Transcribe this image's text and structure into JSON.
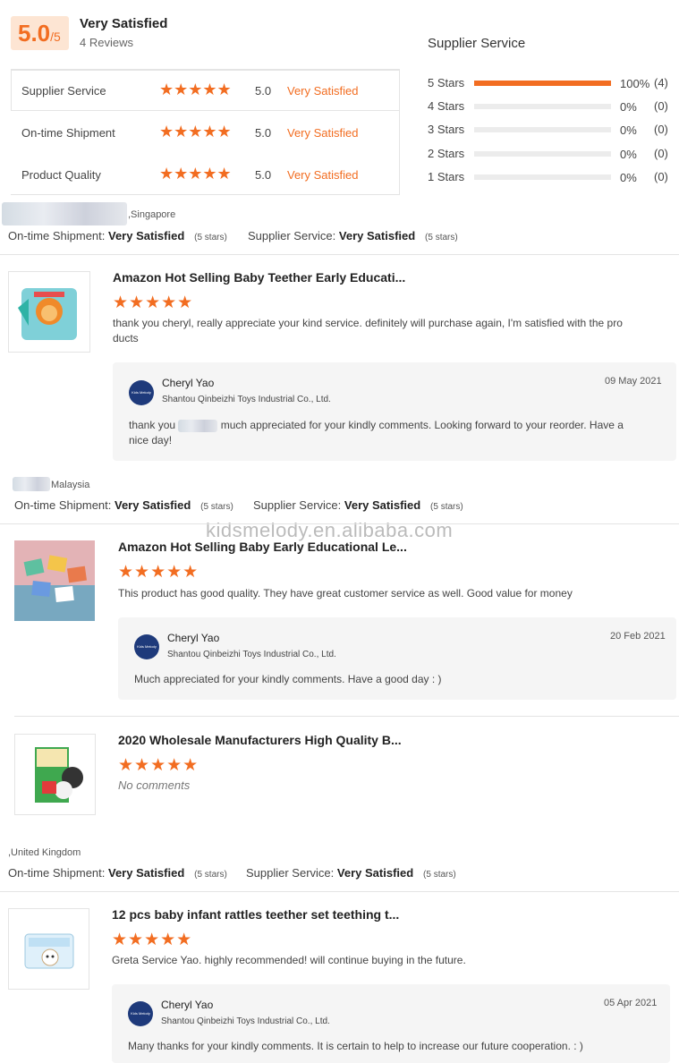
{
  "summary": {
    "score": "5.0",
    "score_suffix": "/5",
    "label": "Very Satisfied",
    "reviews": "4 Reviews"
  },
  "ratings": [
    {
      "label": "Supplier Service",
      "score": "5.0",
      "status": "Very Satisfied"
    },
    {
      "label": "On-time Shipment",
      "score": "5.0",
      "status": "Very Satisfied"
    },
    {
      "label": "Product Quality",
      "score": "5.0",
      "status": "Very Satisfied"
    }
  ],
  "distribution": {
    "title": "Supplier Service",
    "rows": [
      {
        "label": "5 Stars",
        "fraction": 1.0,
        "pct": "100%",
        "count": "(4)"
      },
      {
        "label": "4 Stars",
        "fraction": 0.0,
        "pct": "0%",
        "count": "(0)"
      },
      {
        "label": "3 Stars",
        "fraction": 0.0,
        "pct": "0%",
        "count": "(0)"
      },
      {
        "label": "2 Stars",
        "fraction": 0.0,
        "pct": "0%",
        "count": "(0)"
      },
      {
        "label": "1 Stars",
        "fraction": 0.0,
        "pct": "0%",
        "count": "(0)"
      }
    ]
  },
  "stars_glyph": "★★★★★",
  "meta_labels": {
    "shipment": "On-time Shipment:",
    "service": "Supplier Service:",
    "value": "Very Satisfied",
    "stars_note": "(5 stars)"
  },
  "reviews": [
    {
      "location": ",Singapore",
      "product": "Amazon Hot Selling Baby Teether Early Educati...",
      "comment_line1": "thank you cheryl, really appreciate your kind service. definitely will purchase again, I'm satisfied with the pro",
      "comment_line2": "ducts",
      "reply": {
        "name": "Cheryl Yao",
        "company": "Shantou Qinbeizhi Toys Industrial Co., Ltd.",
        "date": "09 May 2021",
        "line1a": "thank you",
        "line1b": "much appreciated for your kindly comments. Looking forward to your reorder. Have a",
        "line2": "nice day!"
      }
    },
    {
      "location": "Malaysia",
      "product": "Amazon Hot Selling Baby Early Educational Le...",
      "comment_line1": "This product has good quality. They have great customer service as well. Good value for money",
      "reply": {
        "name": "Cheryl Yao",
        "company": "Shantou Qinbeizhi Toys Industrial Co., Ltd.",
        "date": "20 Feb 2021",
        "line1": "Much appreciated for your kindly comments. Have a good day : )"
      }
    },
    {
      "product": "2020 Wholesale Manufacturers High Quality B...",
      "no_comments": "No comments"
    },
    {
      "location": ",United Kingdom",
      "product": "12 pcs baby infant rattles teether set teething t...",
      "comment_line1": "Greta Service Yao. highly recommended! will continue buying in the future.",
      "reply": {
        "name": "Cheryl Yao",
        "company": "Shantou Qinbeizhi Toys Industrial Co., Ltd.",
        "date": "05 Apr 2021",
        "line1": "Many thanks for your kindly comments. It is certain to help to increase our future cooperation. : )"
      }
    }
  ],
  "avatar_text": "Kids Melody",
  "watermark": "kidsmelody.en.alibaba.com",
  "colors": {
    "accent": "#f26d21",
    "score_bg": "#fde5d3",
    "avatar": "#1e3a7b"
  }
}
